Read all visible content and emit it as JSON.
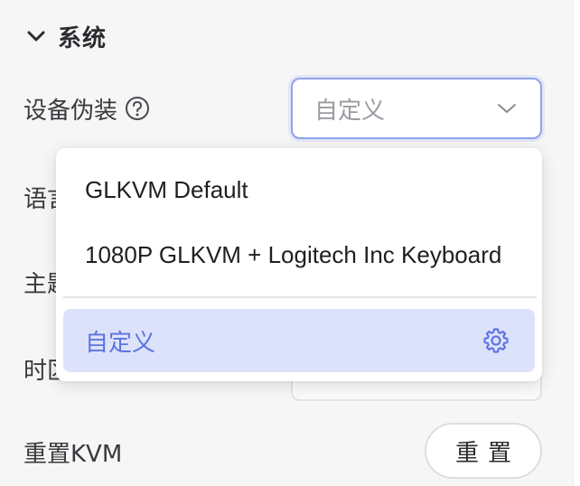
{
  "section": {
    "title": "系统",
    "icon": "chevron-down-icon"
  },
  "rows": {
    "device_disguise": {
      "label": "设备伪装",
      "help_icon": "question-circle-icon",
      "select_value": "自定义"
    },
    "language": {
      "label_visible": "语言"
    },
    "theme": {
      "label_visible": "主题"
    },
    "timezone": {
      "label_visible": "时区"
    },
    "reset": {
      "label": "重置KVM",
      "button_label": "重置"
    }
  },
  "dropdown": {
    "options": [
      {
        "label": "GLKVM Default"
      },
      {
        "label": "1080P GLKVM + Logitech Inc Keyboard"
      },
      {
        "label": "自定义",
        "selected": true,
        "icon": "gear-icon"
      }
    ]
  },
  "colors": {
    "accent": "#5b73e0",
    "selected_bg": "#dde2fb",
    "focus_border": "#8fa3ef"
  }
}
